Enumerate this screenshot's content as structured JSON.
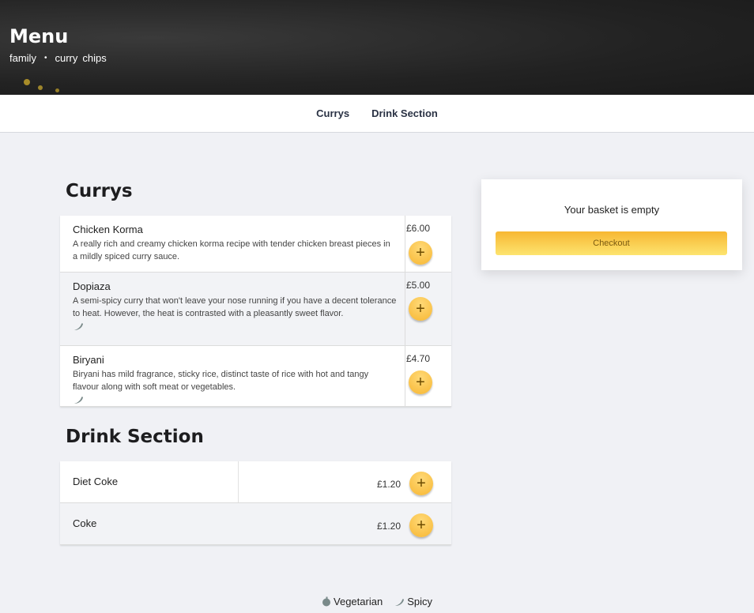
{
  "header": {
    "title": "Menu",
    "tags": [
      "family",
      "curry",
      "chips"
    ]
  },
  "nav": {
    "links": [
      "Currys",
      "Drink Section"
    ]
  },
  "currys": {
    "title": "Currys",
    "items": [
      {
        "name": "Chicken Korma",
        "description": "A really rich and creamy chicken korma recipe with tender chicken breast pieces in a mildly spiced curry sauce.",
        "price": "£6.00",
        "spicy": false
      },
      {
        "name": "Dopiaza",
        "description": "A semi-spicy curry that won't leave your nose running if you have a decent tolerance to heat. However, the heat is contrasted with a pleasantly sweet flavor.",
        "price": "£5.00",
        "spicy": true
      },
      {
        "name": "Biryani",
        "description": "Biryani has mild fragrance, sticky rice, distinct taste of rice with hot and tangy flavour along with soft meat or vegetables.",
        "price": "£4.70",
        "spicy": true
      }
    ]
  },
  "drinks": {
    "title": "Drink Section",
    "items": [
      {
        "name": "Diet Coke",
        "price": "£1.20"
      },
      {
        "name": "Coke",
        "price": "£1.20"
      }
    ]
  },
  "basket": {
    "empty_text": "Your basket is empty",
    "checkout_label": "Checkout"
  },
  "legend": {
    "vegetarian": "Vegetarian",
    "spicy": "Spicy"
  },
  "icons": {
    "add": "plus-icon",
    "spicy": "chili-icon",
    "vegetarian": "leaf-icon"
  },
  "colors": {
    "accent_start": "#f7b733",
    "accent_end": "#fde46f",
    "hero_bg": "#222222",
    "page_bg": "#f0f1f5"
  }
}
